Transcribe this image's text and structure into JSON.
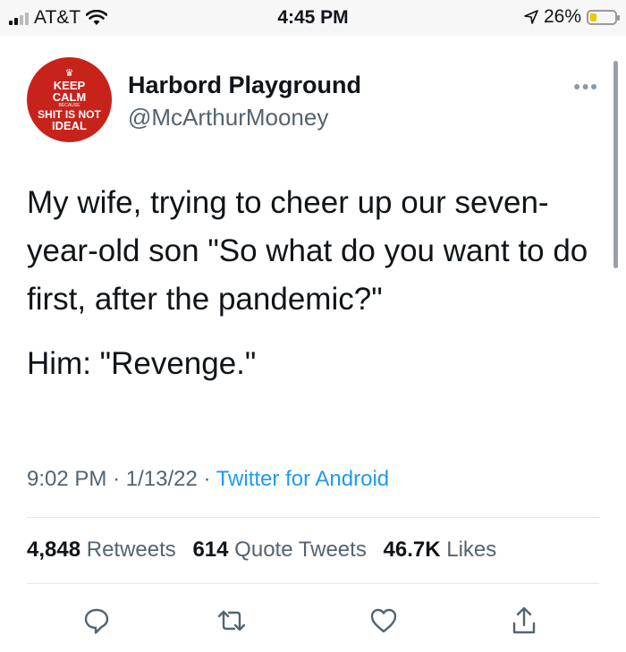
{
  "status_bar": {
    "carrier": "AT&T",
    "time": "4:45 PM",
    "battery": "26%",
    "battery_level": 0.26
  },
  "avatar": {
    "line1": "KEEP",
    "line2": "CALM",
    "line3": "BECAUSE",
    "line4": "SHIT IS NOT",
    "line5": "IDEAL"
  },
  "user": {
    "display_name": "Harbord Playground",
    "handle": "@McArthurMooney"
  },
  "tweet": {
    "text_1": "My wife, trying to cheer up our seven-year-old son \"So what do you want to do first, after the pandemic?\"",
    "text_2": "Him: \"Revenge.\""
  },
  "meta": {
    "time": "9:02 PM",
    "sep1": "·",
    "date": "1/13/22",
    "sep2": "·",
    "source": "Twitter for Android"
  },
  "stats": {
    "retweets_count": "4,848",
    "retweets_label": "Retweets",
    "quotes_count": "614",
    "quotes_label": "Quote Tweets",
    "likes_count": "46.7K",
    "likes_label": "Likes"
  },
  "icons": {
    "reply": "reply-icon",
    "retweet": "retweet-icon",
    "like": "heart-icon",
    "share": "share-icon",
    "more": "more-dots-icon",
    "signal": "signal-icon",
    "wifi": "wifi-icon",
    "location": "location-arrow-icon",
    "battery": "battery-icon",
    "crown": "crown-icon"
  },
  "colors": {
    "link": "#1d9bf0",
    "secondary_text": "#536471",
    "avatar_bg": "#c8231b",
    "battery_fill": "#f2c500"
  }
}
